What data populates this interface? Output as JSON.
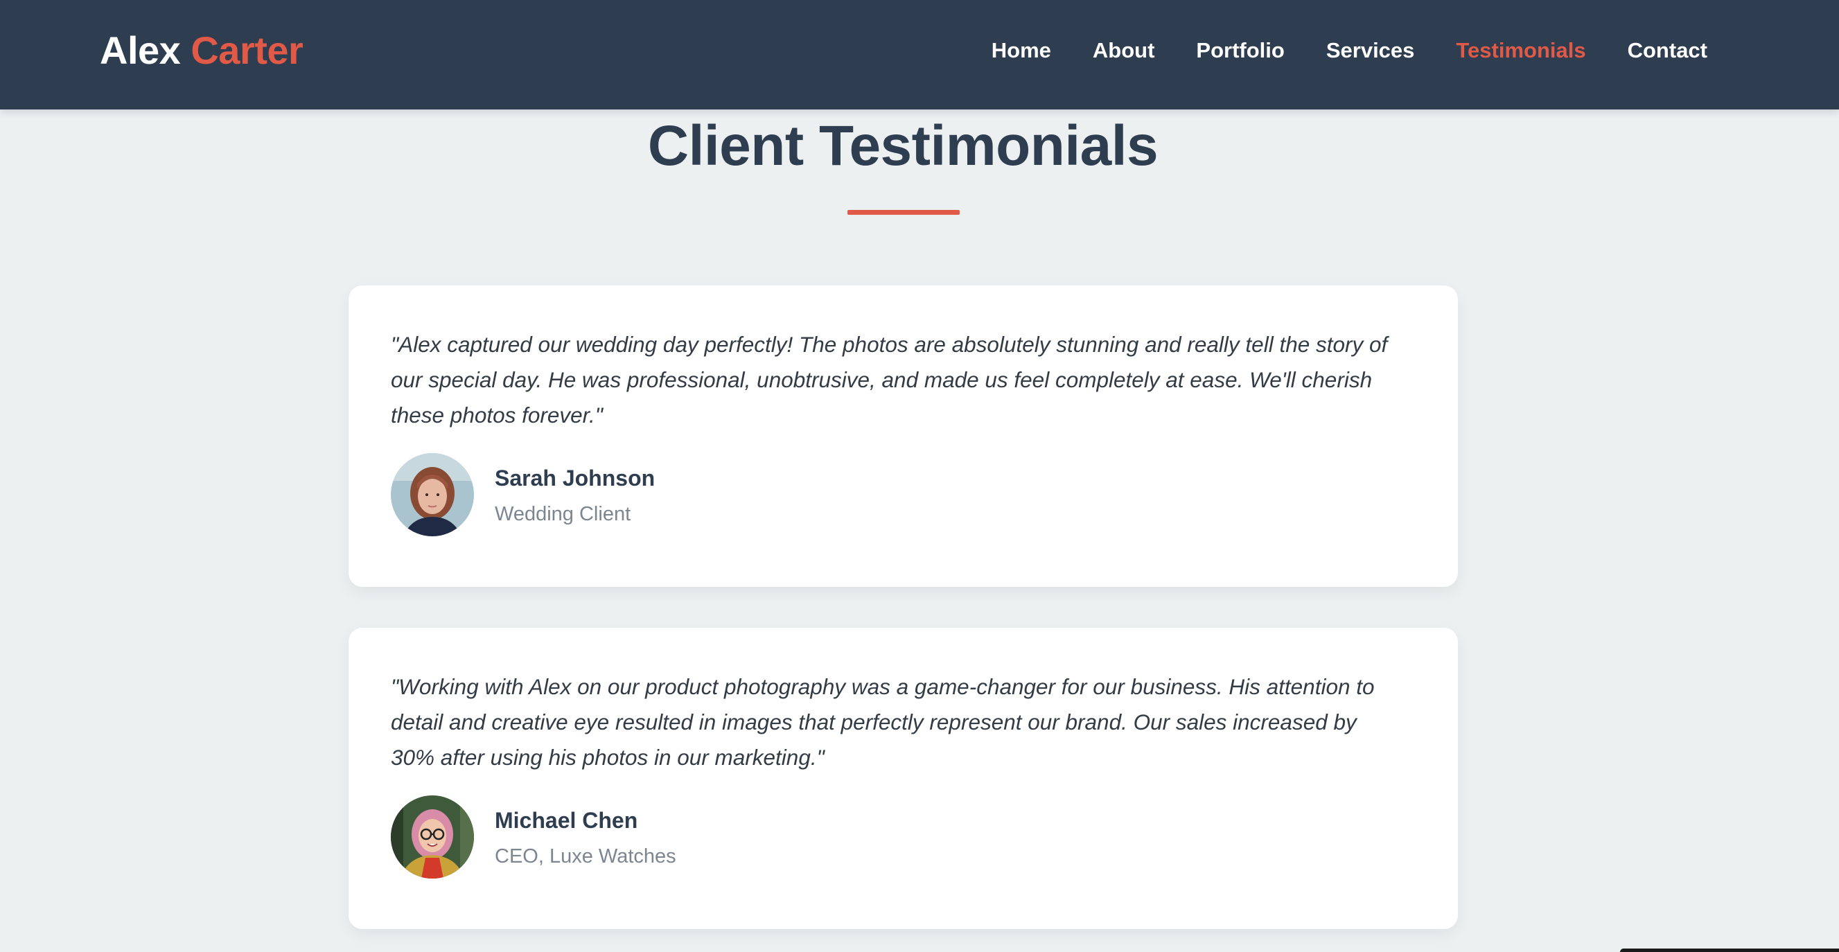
{
  "header": {
    "logo_first": "Alex",
    "logo_second": "Carter",
    "nav": [
      {
        "label": "Home",
        "active": false
      },
      {
        "label": "About",
        "active": false
      },
      {
        "label": "Portfolio",
        "active": false
      },
      {
        "label": "Services",
        "active": false
      },
      {
        "label": "Testimonials",
        "active": true
      },
      {
        "label": "Contact",
        "active": false
      }
    ]
  },
  "section": {
    "title": "Client Testimonials"
  },
  "testimonials": [
    {
      "quote": "\"Alex captured our wedding day perfectly! The photos are absolutely stunning and really tell the story of our special day. He was professional, unobtrusive, and made us feel completely at ease. We'll cherish these photos forever.\"",
      "name": "Sarah Johnson",
      "role": "Wedding Client",
      "avatar": "woman-portrait-photo"
    },
    {
      "quote": "\"Working with Alex on our product photography was a game-changer for our business. His attention to detail and creative eye resulted in images that perfectly represent our brand. Our sales increased by 30% after using his photos in our marketing.\"",
      "name": "Michael Chen",
      "role": "CEO, Luxe Watches",
      "avatar": "person-with-glasses-portrait-photo"
    }
  ],
  "colors": {
    "nav_bg": "#2f3d50",
    "accent": "#e05a47",
    "page_bg": "#ecf0f1",
    "card_bg": "#ffffff"
  }
}
